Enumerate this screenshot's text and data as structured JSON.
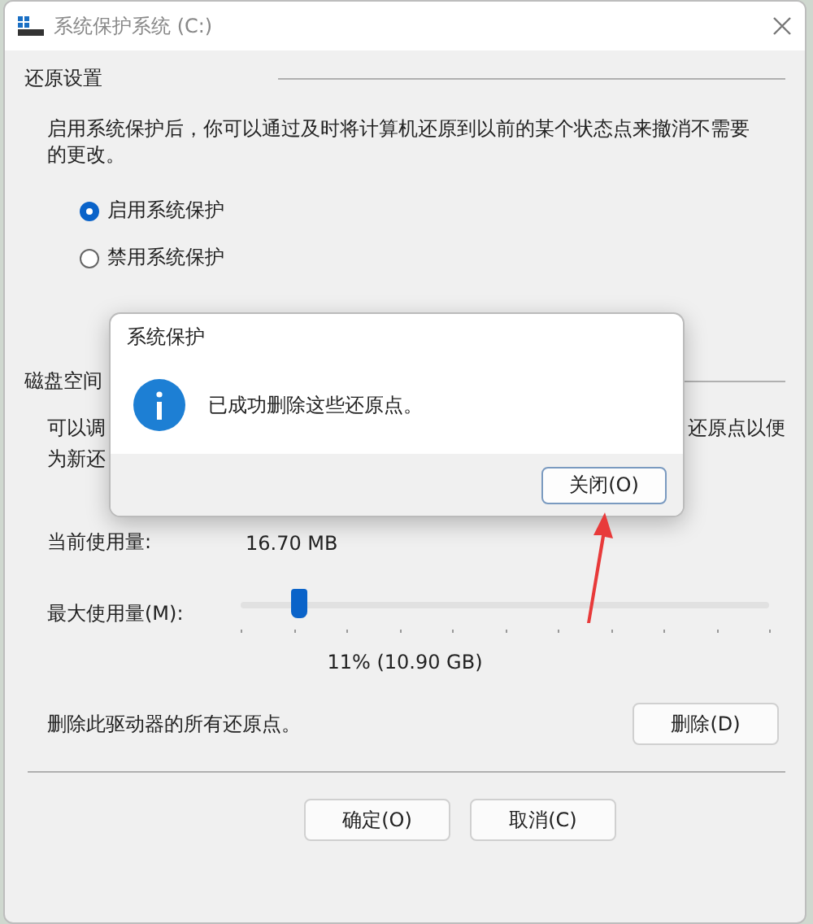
{
  "window": {
    "title": "系统保护系统 (C:)"
  },
  "restore_settings": {
    "heading": "还原设置",
    "description": "启用系统保护后，你可以通过及时将计算机还原到以前的某个状态点来撤消不需要的更改。",
    "options": [
      {
        "label": "启用系统保护",
        "selected": true
      },
      {
        "label": "禁用系统保护",
        "selected": false
      }
    ]
  },
  "disk_space": {
    "heading": "磁盘空间",
    "line_1_left": "可以调",
    "line_1_right": "还原点以便",
    "line_2": "为新还",
    "current_usage_label": "当前使用量:",
    "current_usage_value": "16.70 MB",
    "max_usage_label": "最大使用量(M):",
    "max_usage": {
      "level": 0.11
    },
    "max_usage_reading": "11% (10.90 GB)",
    "delete_text": "删除此驱动器的所有还原点。",
    "delete_button": "删除(D)"
  },
  "buttons": [
    "确定(O)",
    "取消(C)"
  ],
  "message_dialog": {
    "title": "系统保护",
    "message": "已成功删除这些还原点。",
    "button": "关闭(O)"
  }
}
